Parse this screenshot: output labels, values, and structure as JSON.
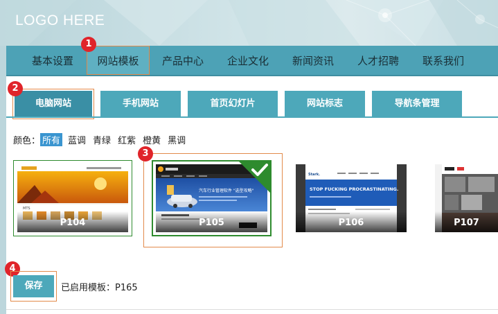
{
  "header": {
    "logo": "LOGO HERE"
  },
  "mainnav": {
    "items": [
      {
        "label": "基本设置"
      },
      {
        "label": "网站模板",
        "active": true
      },
      {
        "label": "产品中心"
      },
      {
        "label": "企业文化"
      },
      {
        "label": "新闻资讯"
      },
      {
        "label": "人才招聘"
      },
      {
        "label": "联系我们"
      }
    ]
  },
  "subtabs": {
    "items": [
      {
        "label": "电脑网站",
        "active": true
      },
      {
        "label": "手机网站"
      },
      {
        "label": "首页幻灯片"
      },
      {
        "label": "网站标志"
      },
      {
        "label": "导航条管理"
      }
    ]
  },
  "filter": {
    "label": "颜色：",
    "options": [
      "所有",
      "蓝调",
      "青绿",
      "红紫",
      "橙黄",
      "黑调"
    ],
    "selected": "所有"
  },
  "templates": [
    {
      "name": "P104",
      "thumb_texts": [
        "MTS"
      ]
    },
    {
      "name": "P105",
      "selected": true,
      "thumb_texts": [
        "汽车行业管理软件 \"选型攻略\""
      ]
    },
    {
      "name": "P106",
      "thumb_texts": [
        "Stark.",
        "STOP FUCKING PROCRASTINATING."
      ]
    },
    {
      "name": "P107",
      "thumb_texts": []
    }
  ],
  "badges": [
    "1",
    "2",
    "3",
    "4"
  ],
  "save": {
    "button_label": "保存",
    "enabled_text": "已启用模板：P165"
  },
  "colors": {
    "nav_bg": "#4da2b6",
    "tab_bg": "#4da8ba",
    "highlight_border": "#e28a4a",
    "badge_red": "#e0242a",
    "selected_green": "#2e8b2e",
    "filter_active": "#3a95d0"
  }
}
